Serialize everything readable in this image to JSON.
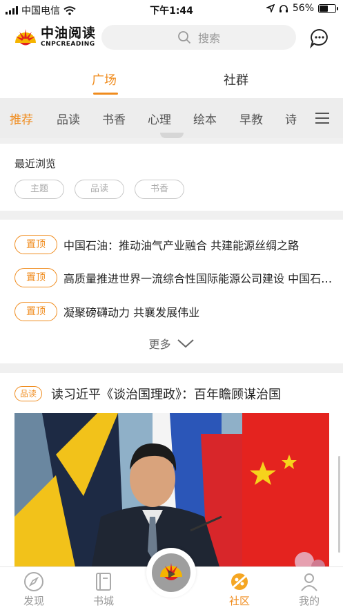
{
  "status_bar": {
    "carrier": "中国电信",
    "time": "下午1:44",
    "battery_percent": "56%",
    "battery_level": 0.56
  },
  "header": {
    "logo_cn": "中油阅读",
    "logo_en": "CNPCREADING",
    "search_placeholder": "搜索"
  },
  "main_tabs": [
    {
      "label": "广场",
      "active": true
    },
    {
      "label": "社群",
      "active": false
    }
  ],
  "categories": [
    {
      "label": "推荐",
      "active": true
    },
    {
      "label": "品读"
    },
    {
      "label": "书香"
    },
    {
      "label": "心理"
    },
    {
      "label": "绘本"
    },
    {
      "label": "早教"
    },
    {
      "label": "诗"
    }
  ],
  "recent": {
    "title": "最近浏览",
    "chips": [
      "主题",
      "品读",
      "书香"
    ]
  },
  "pinned": {
    "badge": "置顶",
    "items": [
      "中国石油：推动油气产业融合 共建能源丝绸之路",
      "高质量推进世界一流综合性国际能源公司建设 中国石油天然气集团有限公司",
      "凝聚磅礴动力 共襄发展伟业"
    ],
    "more_label": "更多"
  },
  "article": {
    "badge": "品读",
    "title": "读习近平《谈治国理政》：百年瞻顾谋治国"
  },
  "bottom_nav": [
    {
      "label": "发现",
      "icon": "compass-icon"
    },
    {
      "label": "书城",
      "icon": "book-icon"
    },
    {
      "label": "社区",
      "icon": "community-icon",
      "active": true
    },
    {
      "label": "我的",
      "icon": "user-icon"
    }
  ],
  "colors": {
    "accent": "#f08c1e",
    "logo_red": "#e02020",
    "logo_yellow": "#f5b400"
  }
}
